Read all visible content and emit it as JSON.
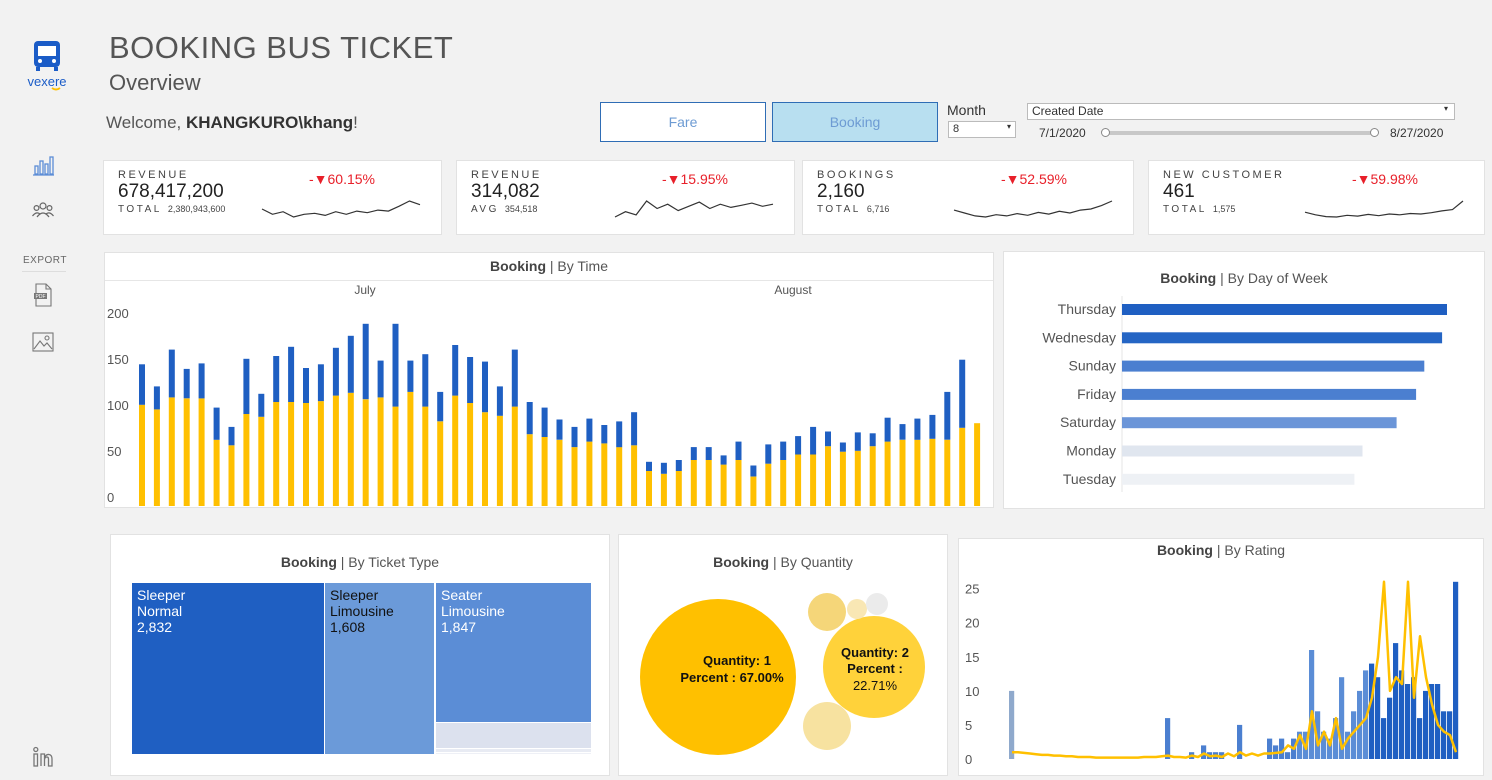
{
  "brand": {
    "logo_text": "vexere"
  },
  "header": {
    "title": "BOOKING BUS TICKET",
    "subtitle": "Overview",
    "welcome_prefix": "Welcome, ",
    "user": "KHANGKURO\\khang",
    "welcome_suffix": "!"
  },
  "sidebar": {
    "export_label": "EXPORT"
  },
  "toggles": {
    "fare": "Fare",
    "booking": "Booking",
    "active": "booking"
  },
  "filters": {
    "month_label": "Month",
    "month_value": "8",
    "date_field": "Created Date",
    "date_start": "7/1/2020",
    "date_end": "8/27/2020"
  },
  "kpis": [
    {
      "label": "REVENUE",
      "value": "678,417,200",
      "sub_label": "TOTAL",
      "sub_value": "2,380,943,600",
      "delta": "-▼60.15%",
      "spark": [
        5,
        4,
        4.5,
        3.5,
        4,
        4.2,
        3.8,
        4.5,
        4,
        4.6,
        4.3,
        4.8,
        4.6,
        5.5,
        6.5,
        5.8
      ]
    },
    {
      "label": "REVENUE",
      "value": "314,082",
      "sub_label": "AVG",
      "sub_value": "354,518",
      "delta": "-▼15.95%",
      "spark": [
        4,
        4.5,
        4.2,
        5.5,
        4.8,
        5.2,
        4.6,
        5,
        5.4,
        4.8,
        5.2,
        4.9,
        5.1,
        5.3,
        5,
        5.2
      ]
    },
    {
      "label": "BOOKINGS",
      "value": "2,160",
      "sub_label": "TOTAL",
      "sub_value": "6,716",
      "delta": "-▼52.59%",
      "spark": [
        5,
        4.5,
        4,
        3.8,
        4.2,
        4,
        4.4,
        4.1,
        4.6,
        4.3,
        4.8,
        4.5,
        5,
        5.2,
        5.8,
        6.6
      ]
    },
    {
      "label": "NEW CUSTOMER",
      "value": "461",
      "sub_label": "TOTAL",
      "sub_value": "1,575",
      "delta": "-▼59.98%",
      "spark": [
        5,
        4.4,
        4,
        3.9,
        4.3,
        4.1,
        4.5,
        4.2,
        4.6,
        4.4,
        4.7,
        4.6,
        4.9,
        5.3,
        5.6,
        7.6
      ]
    }
  ],
  "colors": {
    "blue": "#1f5fc2",
    "yellow": "#ffc000",
    "red": "#e8202a",
    "mid_blue": "#5b8dd6",
    "light_blue": "#b8dff0"
  },
  "icons": {
    "logo": "bus-logo-icon",
    "chart": "bar-chart-icon",
    "users": "users-icon",
    "pdf": "pdf-icon",
    "image": "image-icon",
    "linkedin": "linkedin-icon"
  },
  "chart_data": [
    {
      "type": "bar",
      "title_bold": "Booking",
      "title_rest": " | By Time",
      "month_labels": [
        "July",
        "August"
      ],
      "ylim": [
        0,
        200
      ],
      "yticks": [
        0,
        50,
        100,
        150,
        200
      ],
      "series": [
        {
          "name": "yellow",
          "values": [
            110,
            105,
            118,
            117,
            117,
            72,
            66,
            100,
            97,
            113,
            113,
            112,
            114,
            120,
            123,
            116,
            118,
            108,
            124,
            108,
            92,
            120,
            112,
            102,
            98,
            108,
            78,
            75,
            72,
            64,
            70,
            68,
            64,
            66,
            38,
            35,
            38,
            50,
            50,
            45,
            50,
            32,
            46,
            50,
            56,
            56,
            65,
            59,
            60,
            65,
            70,
            72,
            72,
            73,
            72,
            85,
            90
          ]
        },
        {
          "name": "blue",
          "values": [
            44,
            25,
            52,
            32,
            38,
            35,
            20,
            60,
            25,
            50,
            60,
            38,
            40,
            52,
            62,
            82,
            40,
            90,
            34,
            57,
            32,
            55,
            50,
            55,
            32,
            62,
            35,
            32,
            22,
            22,
            25,
            20,
            28,
            36,
            10,
            12,
            12,
            14,
            14,
            10,
            20,
            12,
            21,
            20,
            20,
            30,
            16,
            10,
            20,
            14,
            26,
            17,
            23,
            26,
            52,
            74
          ]
        }
      ]
    },
    {
      "type": "bar",
      "title_bold": "Booking",
      "title_rest": " | By Day of Week",
      "categories": [
        "Thursday",
        "Wednesday",
        "Sunday",
        "Friday",
        "Saturday",
        "Monday",
        "Tuesday"
      ],
      "values": [
        100,
        98.5,
        93,
        90.5,
        84.5,
        74,
        71.5
      ],
      "colors": [
        "#1f5fc2",
        "#2565c4",
        "#4b7fd0",
        "#4b7fd0",
        "#6b95d8",
        "#e0e6ef",
        "#eef1f5"
      ]
    },
    {
      "type": "treemap",
      "title_bold": "Booking",
      "title_rest": " | By Ticket Type",
      "items": [
        {
          "name_line1": "Sleeper",
          "name_line2": "Normal",
          "value_label": "2,832",
          "value": 2832,
          "color": "#1f5fc2"
        },
        {
          "name_line1": "Sleeper",
          "name_line2": "Limousine",
          "value_label": "1,608",
          "value": 1608,
          "color": "#6b9ad9"
        },
        {
          "name_line1": "Seater",
          "name_line2": "Limousine",
          "value_label": "1,847",
          "value": 1847,
          "color": "#5b8dd6"
        }
      ]
    },
    {
      "type": "bubble",
      "title_bold": "Booking",
      "title_rest": " | By Quantity",
      "bubbles": [
        {
          "quantity_label": "Quantity:",
          "quantity": "1",
          "percent_label": "Percent :",
          "percent": "67.00%",
          "value": 67.0,
          "color": "#ffc000"
        },
        {
          "quantity_label": "Quantity:",
          "quantity": "2",
          "percent_label": "Percent :",
          "percent": "22.71%",
          "value": 22.71,
          "color": "#ffd23a"
        },
        {
          "value": 6,
          "color": "#f5d679"
        },
        {
          "value": 3,
          "color": "#f7e2a0"
        },
        {
          "value": 1,
          "color": "#f9e7b4"
        },
        {
          "value": 0.8,
          "color": "#ebebeb"
        }
      ]
    },
    {
      "type": "bar+line",
      "title_bold": "Booking",
      "title_rest": " | By Rating",
      "ylim": [
        0,
        27
      ],
      "yticks": [
        0,
        5,
        10,
        15,
        20,
        25
      ],
      "bars": [
        10,
        0,
        0,
        0,
        0,
        0,
        0,
        0,
        0,
        0,
        0,
        0,
        0,
        0,
        0,
        0,
        0,
        0,
        0,
        0,
        0,
        0,
        0,
        0,
        0,
        0,
        6,
        0,
        0,
        0,
        1,
        0,
        2,
        1,
        1,
        1,
        0,
        0,
        5,
        0,
        0,
        0,
        0,
        3,
        2,
        3,
        1,
        3,
        4,
        4,
        16,
        7,
        4,
        3,
        6,
        12,
        4,
        7,
        10,
        13,
        14,
        12,
        6,
        9,
        17,
        13,
        11,
        12,
        6,
        10,
        11,
        11,
        7,
        7,
        26
      ],
      "line": [
        1,
        1,
        0.9,
        0.8,
        0.7,
        0.6,
        0.6,
        0.5,
        0.5,
        0.4,
        0.4,
        0.3,
        0.3,
        0.3,
        0.2,
        0.2,
        0.2,
        0.2,
        0.2,
        0.2,
        0.2,
        0.2,
        0.3,
        0.3,
        0.3,
        0.4,
        0.5,
        0.3,
        0.3,
        0.2,
        0.5,
        0.3,
        0.8,
        0.4,
        0.5,
        0.3,
        0.8,
        0.4,
        1,
        0.5,
        0.8,
        0.5,
        0.8,
        0.8,
        0.9,
        1,
        2,
        1.5,
        3.5,
        1.5,
        7,
        2,
        4,
        2,
        6,
        1.5,
        3,
        4,
        5,
        6,
        9,
        15,
        26,
        10,
        12,
        11,
        26,
        9,
        18,
        12,
        8,
        5,
        4,
        3.5,
        1
      ]
    }
  ]
}
